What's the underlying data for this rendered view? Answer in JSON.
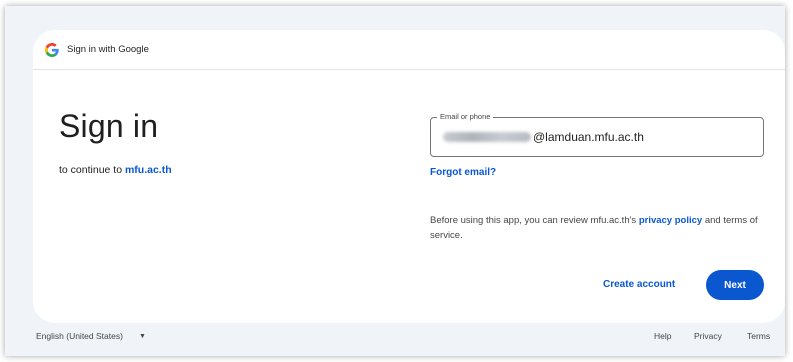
{
  "header": {
    "title": "Sign in with Google"
  },
  "main": {
    "heading": "Sign in",
    "continue_prefix": "to continue to",
    "continue_site": "mfu.ac.th"
  },
  "email": {
    "label": "Email or phone",
    "value_domain": "@lamduan.mfu.ac.th"
  },
  "links": {
    "forgot_email": "Forgot email?"
  },
  "privacy": {
    "prefix": "Before using this app, you can review mfu.ac.th's",
    "link": "privacy policy",
    "suffix": "and terms of service."
  },
  "actions": {
    "create_account": "Create account",
    "next": "Next"
  },
  "footer": {
    "language": "English (United States)",
    "help": "Help",
    "privacy": "Privacy",
    "terms": "Terms"
  },
  "colors": {
    "accent": "#0b57d0",
    "background": "#f0f4f9"
  }
}
